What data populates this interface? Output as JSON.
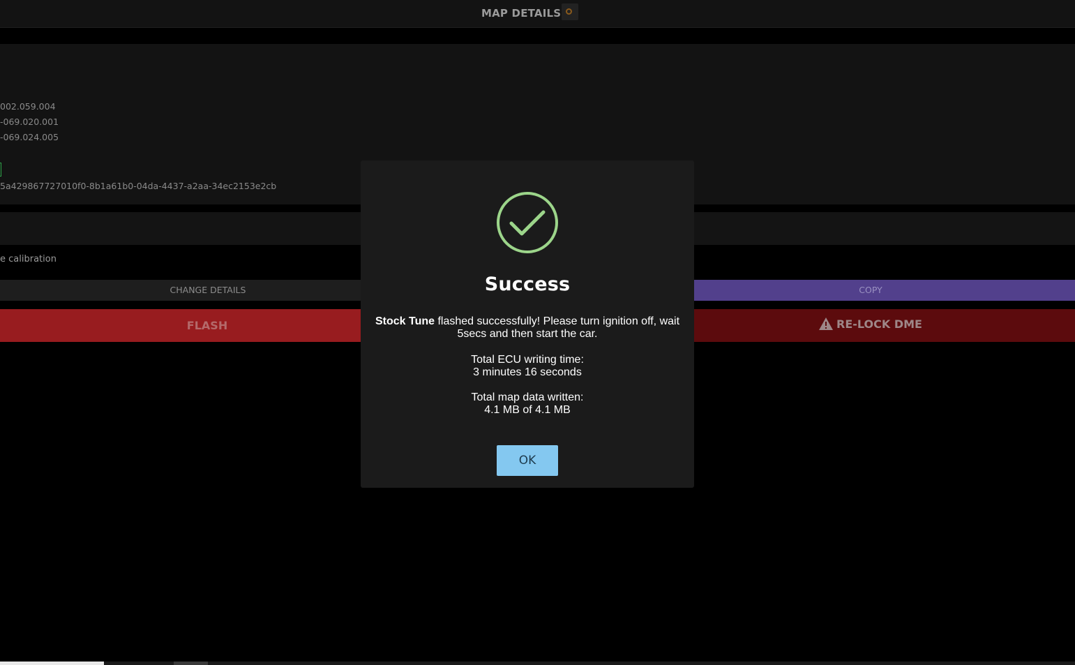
{
  "header": {
    "title": "MAP DETAILS",
    "icon": "dme-status-icon"
  },
  "info": {
    "lines": [
      "002.059.004",
      "-069.020.001",
      "-069.024.005"
    ],
    "id_value": "5a429867727010f0-8b1a61b0-04da-4437-a2aa-34ec2153e2cb"
  },
  "section": {
    "calibration_text": "e calibration"
  },
  "buttons": {
    "change_details": "CHANGE DETAILS",
    "copy": "COPY",
    "flash": "FLASH",
    "relock": "RE-LOCK DME"
  },
  "modal": {
    "icon": "success-check-icon",
    "title": "Success",
    "message_bold": "Stock Tune",
    "message_rest": " flashed successfully! Please turn ignition off, wait 5secs and then start the car.",
    "writing_time_label": "Total ECU writing time:",
    "writing_time_value": "3 minutes 16 seconds",
    "data_written_label": "Total map data written:",
    "data_written_value": "4.1 MB of 4.1 MB",
    "ok_label": "OK"
  },
  "colors": {
    "success_green": "#9cd58a",
    "ok_button": "#84c8f0",
    "copy_button": "#52408c",
    "flash_button": "#981c1f",
    "relock_button": "#5c0b0d"
  }
}
